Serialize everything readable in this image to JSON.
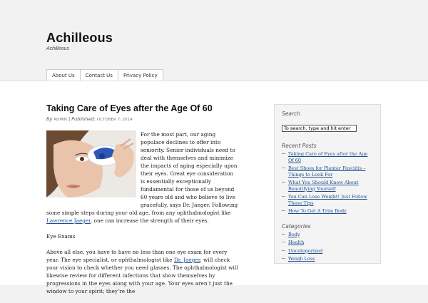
{
  "site": {
    "title": "Achilleous",
    "description": "Achilleous"
  },
  "nav": {
    "items": [
      "About Us",
      "Contact Us",
      "Privacy Policy"
    ]
  },
  "post": {
    "title": "Taking Care of Eyes after the Age Of 60",
    "byline_by": "By",
    "author": "ADMIN",
    "byline_published": "| Published:",
    "date": "OCTOBER 7, 2014",
    "p1_a": "For the most part, our aging populace declines to offer into seniority. Senior individuals need to deal with themselves and minimize the impacts of aging especially upon their eyes. Great eye consideration is essentially exceptionally fundamental for those of us beyond 60 years old and who believe to live gracefully, says Dr. Jaeger. Following some simple steps during your old age, from any ophthalmologist like ",
    "p1_link": "Lawrence Jaeger",
    "p1_b": ", one can increase the strength of their eyes.",
    "p2": "Eye Exams",
    "p3_a": "Above all else, you have to have no less than one eye exam for every year. The eye specialist, or ophthalmologist like ",
    "p3_link": "Dr. Jaeger",
    "p3_b": ", will check your vision to check whether you need glasses. The ophthalmologist will likewise review for different infections that show themselves by progressions in the eyes along with your age. Your eyes aren’t just the window to your spirit; they’re the"
  },
  "sidebar": {
    "search_title": "Search",
    "search_value": "To search, type and hit enter",
    "recent_title": "Recent Posts",
    "recent_posts": [
      "Taking Care of Eyes after the Age Of 60",
      "Best Shoes for Plantar Fasciitis – Things to Look For",
      "What You Should Know About Beautifying Yourself",
      "You Can Lose Weight! Just Follow These Tips",
      "How To Get A Trim Body"
    ],
    "categories_title": "Categories",
    "categories": [
      "Body",
      "Health",
      "Uncategorized",
      "Weigh Loss"
    ]
  }
}
